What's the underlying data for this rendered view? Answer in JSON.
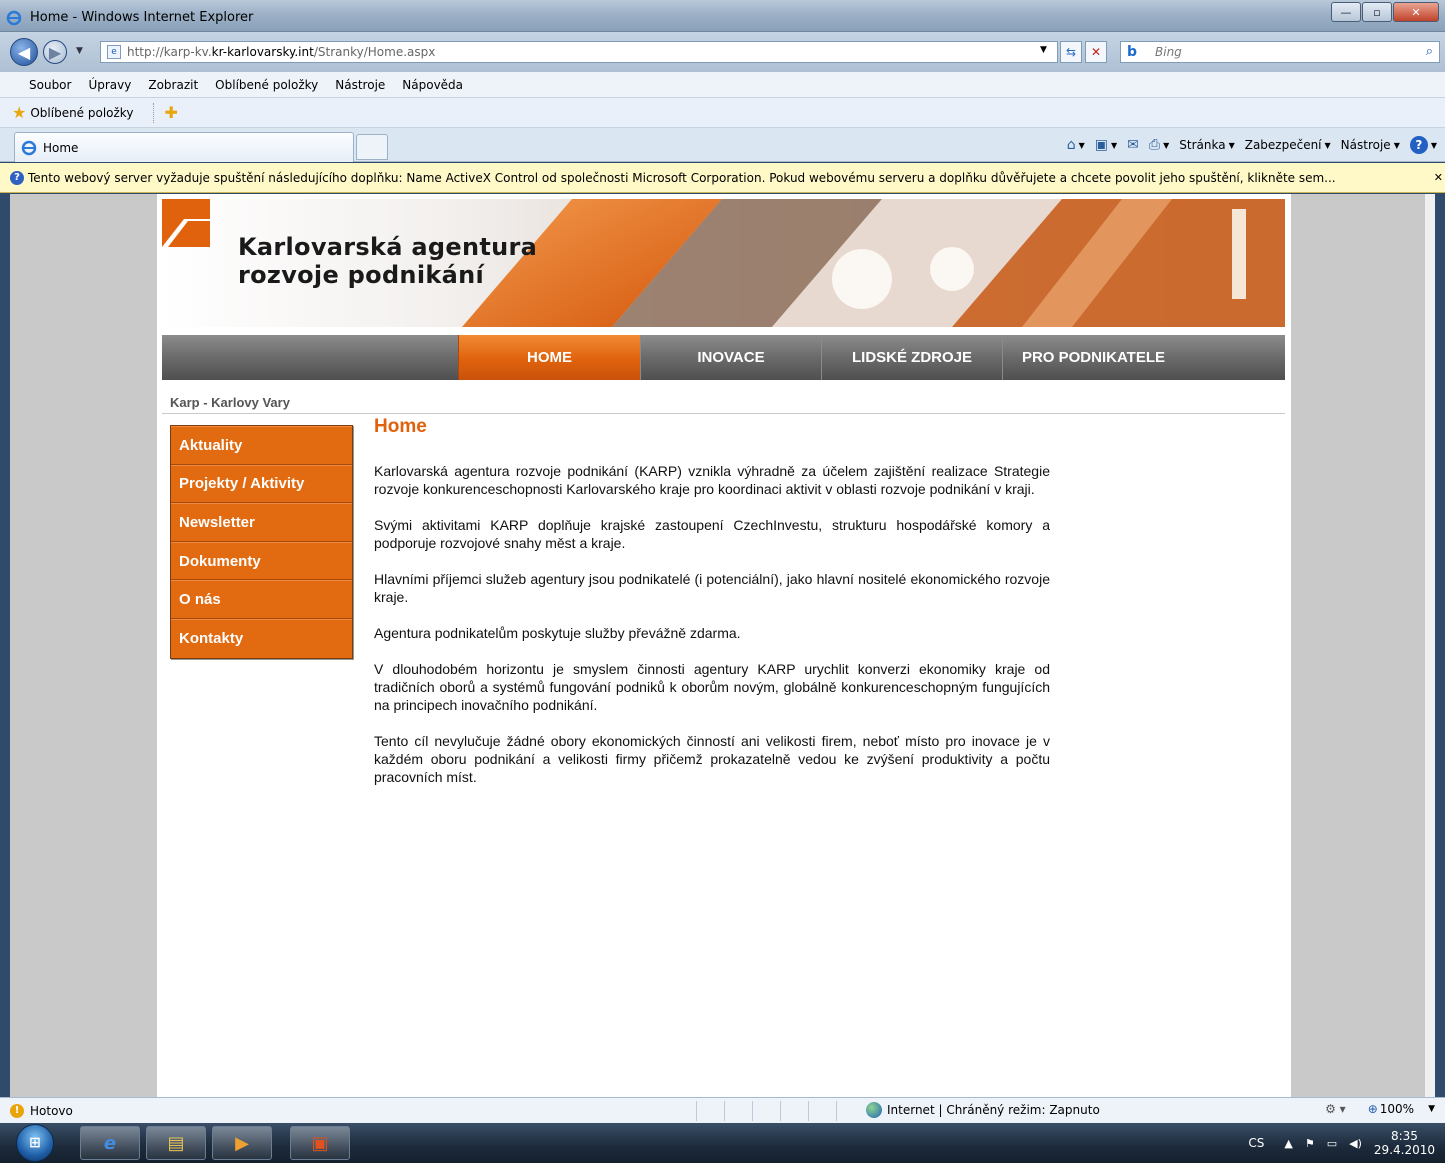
{
  "window": {
    "title": "Home - Windows Internet Explorer"
  },
  "address": {
    "url_prefix": "http://karp-kv.",
    "url_domain": "kr-karlovarsky.int",
    "url_suffix": "/Stranky/Home.aspx",
    "search_placeholder": "Bing"
  },
  "menu": [
    "Soubor",
    "Úpravy",
    "Zobrazit",
    "Oblíbené položky",
    "Nástroje",
    "Nápověda"
  ],
  "favorites": {
    "label": "Oblíbené položky"
  },
  "tab": {
    "title": "Home"
  },
  "commands": {
    "page": "Stránka",
    "security": "Zabezpečení",
    "tools": "Nástroje"
  },
  "infobar": {
    "text": "Tento webový server vyžaduje spuštění následujícího doplňku: Name ActiveX Control od společnosti Microsoft Corporation. Pokud webovému serveru a doplňku důvěřujete a chcete povolit jeho spuštění, klikněte sem..."
  },
  "site": {
    "logo_line1": "Karlovarská agentura",
    "logo_line2": "rozvoje podnikání",
    "nav": [
      "HOME",
      "INOVACE",
      "LIDSKÉ ZDROJE",
      "PRO PODNIKATELE"
    ],
    "breadcrumb": "Karp - Karlovy Vary",
    "sidebar": [
      "Aktuality",
      "Projekty / Aktivity",
      "Newsletter",
      "Dokumenty",
      "O nás",
      "Kontakty"
    ],
    "heading": "Home",
    "paragraphs": [
      "Karlovarská agentura rozvoje podnikání (KARP) vznikla výhradně za účelem zajištění realizace Strategie rozvoje konkurenceschopnosti Karlovarského kraje pro koordinaci aktivit v oblasti rozvoje podnikání v kraji.",
      "Svými aktivitami KARP doplňuje krajské zastoupení CzechInvestu, strukturu hospodářské komory a podporuje rozvojové snahy měst a kraje.",
      "Hlavními příjemci služeb agentury jsou podnikatelé (i potenciální), jako hlavní nositelé ekonomického rozvoje kraje.",
      "Agentura podnikatelům poskytuje služby převážně zdarma.",
      "V dlouhodobém horizontu je smyslem činnosti agentury KARP urychlit konverzi ekonomiky kraje od tradičních oborů a systémů fungování podniků k oborům novým, globálně konkurenceschopným fungujících na principech inovačního podnikání.",
      "Tento cíl nevylučuje žádné obory ekonomických činností ani velikosti firem, neboť místo pro inovace je v každém oboru podnikání a velikosti firmy přičemž prokazatelně vedou ke zvýšení produktivity a počtu pracovních míst."
    ]
  },
  "status": {
    "left": "Hotovo",
    "zone": "Internet | Chráněný režim: Zapnuto",
    "zoom": "100%"
  },
  "taskbar": {
    "lang": "CS",
    "time": "8:35",
    "date": "29.4.2010"
  },
  "colors": {
    "accent": "#e0620d",
    "nav_gray": "#6e6e6e"
  }
}
